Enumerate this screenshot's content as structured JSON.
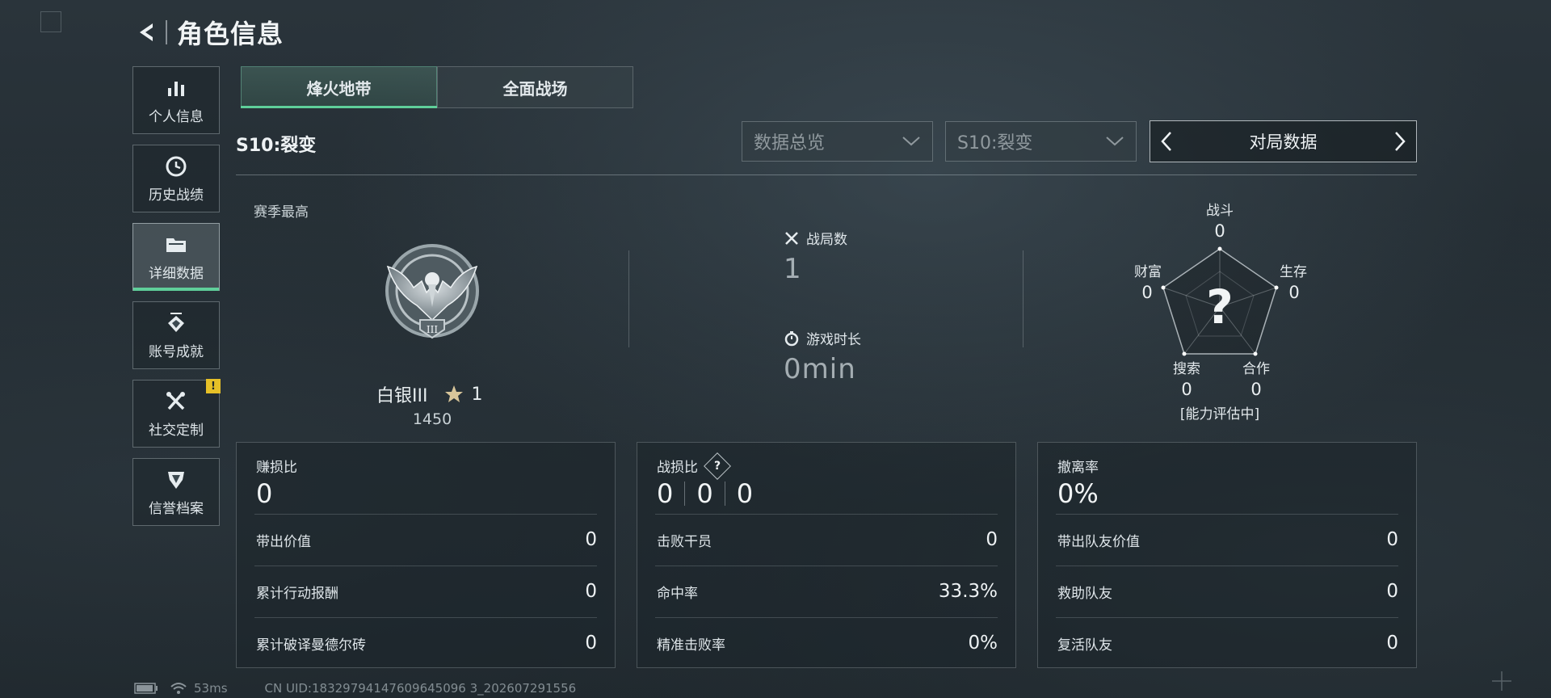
{
  "header": {
    "title": "角色信息"
  },
  "sidebar": {
    "items": [
      {
        "label": "个人信息",
        "icon": "bar-chart-icon"
      },
      {
        "label": "历史战绩",
        "icon": "clock-icon"
      },
      {
        "label": "详细数据",
        "icon": "folder-icon",
        "active": true
      },
      {
        "label": "账号成就",
        "icon": "achievement-icon"
      },
      {
        "label": "社交定制",
        "icon": "tools-icon",
        "badge": "!"
      },
      {
        "label": "信誉档案",
        "icon": "shield-icon"
      }
    ]
  },
  "tabs": [
    {
      "label": "烽火地带",
      "active": true
    },
    {
      "label": "全面战场",
      "active": false
    }
  ],
  "season": {
    "label": "S10:裂变"
  },
  "filters": {
    "data_select": "数据总览",
    "season_select": "S10:裂变",
    "nav_label": "对局数据"
  },
  "rank": {
    "season_best_label": "赛季最高",
    "tier": "白银III",
    "stars": "1",
    "score": "1450",
    "emblem_numeral": "III"
  },
  "match_stats": {
    "matches_label": "战局数",
    "matches_value": "1",
    "playtime_label": "游戏时长",
    "playtime_value": "0min"
  },
  "radar": {
    "center": "?",
    "status": "[能力评估中]",
    "axes": [
      {
        "label": "战斗",
        "value": "0"
      },
      {
        "label": "生存",
        "value": "0"
      },
      {
        "label": "合作",
        "value": "0"
      },
      {
        "label": "搜索",
        "value": "0"
      },
      {
        "label": "财富",
        "value": "0"
      }
    ]
  },
  "cards": {
    "profit": {
      "label": "赚损比",
      "value": "0",
      "rows": [
        {
          "label": "带出价值",
          "value": "0"
        },
        {
          "label": "累计行动报酬",
          "value": "0"
        },
        {
          "label": "累计破译曼德尔砖",
          "value": "0"
        }
      ]
    },
    "kd": {
      "label": "战损比",
      "help": "?",
      "values": [
        "0",
        "0",
        "0"
      ],
      "rows": [
        {
          "label": "击败干员",
          "value": "0"
        },
        {
          "label": "命中率",
          "value": "33.3%"
        },
        {
          "label": "精准击败率",
          "value": "0%"
        }
      ]
    },
    "extract": {
      "label": "撤离率",
      "value": "0%",
      "rows": [
        {
          "label": "带出队友价值",
          "value": "0"
        },
        {
          "label": "救助队友",
          "value": "0"
        },
        {
          "label": "复活队友",
          "value": "0"
        }
      ]
    }
  },
  "footer": {
    "ping": "53ms",
    "uid": "CN UID:18329794147609645096 3_202607291556"
  },
  "colors": {
    "accent": "#5fcf9a",
    "badge": "#e6c027"
  }
}
